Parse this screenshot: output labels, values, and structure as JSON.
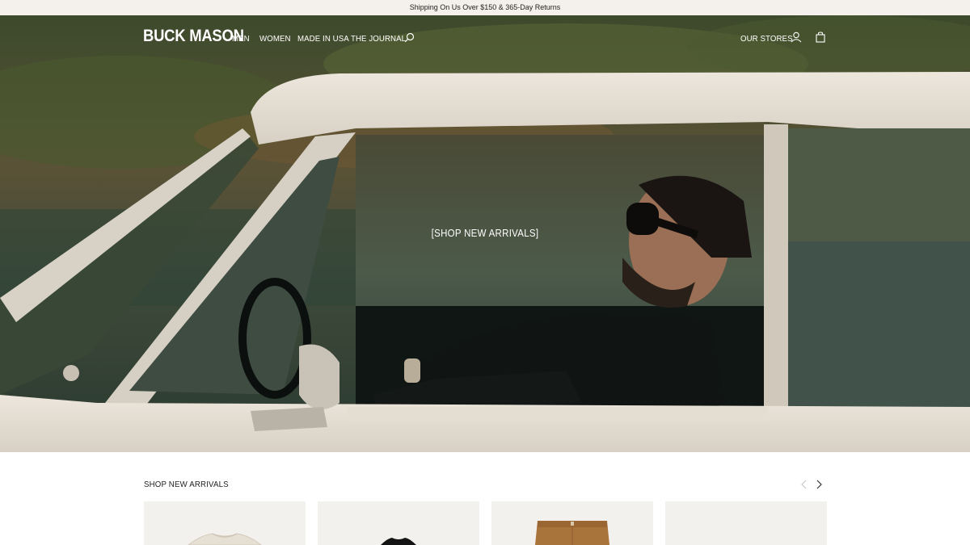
{
  "announcement": {
    "text": "Shipping On Us Over $150 & 365-Day Returns"
  },
  "header": {
    "logo": "BUCK MASON",
    "nav": [
      {
        "label": "MEN"
      },
      {
        "label": "WOMEN"
      },
      {
        "label": "MADE IN USA"
      },
      {
        "label": "THE JOURNAL"
      }
    ],
    "stores_label": "OUR STORES",
    "icons": [
      "search-icon",
      "account-icon",
      "bag-icon"
    ]
  },
  "hero": {
    "cta": "[SHOP NEW ARRIVALS]",
    "image": "man-in-vintage-car"
  },
  "new_arrivals": {
    "title": "SHOP NEW ARRIVALS",
    "products": [
      {
        "image": "cream-sweatshirt"
      },
      {
        "image": "black-tee"
      },
      {
        "image": "tan-pants"
      },
      {
        "image": "blank"
      }
    ]
  },
  "colors": {
    "announcement_bg": "#f4f1ec",
    "card_bg": "#f3f1ee",
    "text_dark": "#222222"
  }
}
